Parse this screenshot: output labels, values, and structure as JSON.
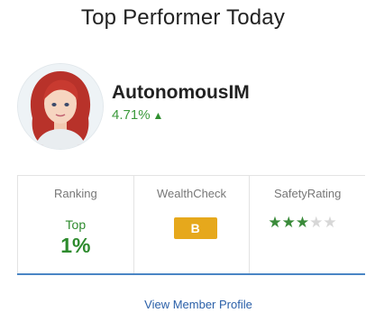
{
  "title": "Top Performer Today",
  "member": {
    "name": "AutonomousIM",
    "change": "4.71%",
    "trend_icon": "up-arrow-icon"
  },
  "stats": {
    "ranking": {
      "label": "Ranking",
      "top_text": "Top",
      "percent": "1%"
    },
    "wealthcheck": {
      "label": "WealthCheck",
      "grade": "B"
    },
    "safety": {
      "label": "SafetyRating",
      "rating": 3,
      "max": 5
    }
  },
  "link": {
    "label": "View Member Profile"
  },
  "colors": {
    "positive": "#2e8b2e",
    "badge": "#e6a81c",
    "link": "#2a5fa8",
    "divider_accent": "#4a86c5"
  }
}
